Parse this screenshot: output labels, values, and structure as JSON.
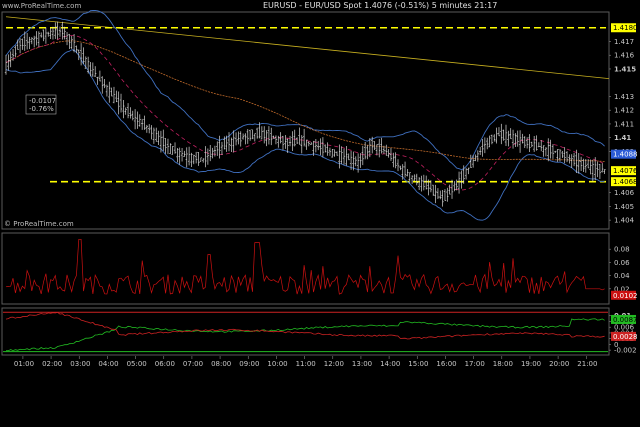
{
  "header": {
    "brand": "www.ProRealTime.com",
    "title": "EURUSD - EUR/USD Spot    1.4076 (-0.51%)    5 minutes  21:17"
  },
  "watermark": "© ProRealTime.com",
  "colors": {
    "background": "#000000",
    "price_bars": "#d8d8d8",
    "bollinger": "#3f6fbf",
    "moving_avg": "#c06a2a",
    "dashed_ma": "#c02060",
    "trendline": "#c8b020",
    "level_line": "#ffff00",
    "volatility": "#cc1111",
    "osc_green": "#22bb22",
    "osc_red": "#cc2222",
    "tag_yellow": "#ffff00",
    "tag_blue": "#2b5bd6"
  },
  "price_panel": {
    "y_ticks": [
      "1.417",
      "1.416",
      "1.415",
      "1.413",
      "1.412",
      "1.411",
      "1.41",
      "1.409",
      "1.406",
      "1.405",
      "1.404"
    ],
    "ylim": [
      1.4035,
      1.419
    ],
    "level_upper": {
      "value": 1.418,
      "label": "1.4180"
    },
    "level_lower": {
      "value": 1.4068,
      "label": "1.4068"
    },
    "last_price_label": "1.4076",
    "band_label": "1.4088",
    "change_box": [
      "-0.0107",
      "-0.76%"
    ]
  },
  "volatility_panel": {
    "y_ticks": [
      "0.08",
      "0.06",
      "0.04",
      "0.02"
    ],
    "ylim": [
      0,
      0.1
    ],
    "last_label": "0.0102"
  },
  "oscillator_panel": {
    "y_ticks": [
      "0.01",
      "0.008",
      "0.006",
      "0.004",
      "0.002",
      "0",
      "-0.002"
    ],
    "ylim": [
      -0.003,
      0.012
    ],
    "green_label": "0.0087",
    "red_label": "0.0028"
  },
  "x_axis": {
    "ticks": [
      "01:00",
      "02:00",
      "03:00",
      "04:00",
      "05:00",
      "06:00",
      "07:00",
      "08:00",
      "09:00",
      "10:00",
      "11:00",
      "12:00",
      "13:00",
      "14:00",
      "15:00",
      "16:00",
      "17:00",
      "18:00",
      "19:00",
      "20:00",
      "21:00"
    ]
  },
  "chart_data": {
    "type": "line",
    "x_hours": [
      0.0,
      0.5,
      1.0,
      1.5,
      2.0,
      2.5,
      3.0,
      3.5,
      4.0,
      4.5,
      5.0,
      5.5,
      6.0,
      6.5,
      7.0,
      7.5,
      8.0,
      8.5,
      9.0,
      9.5,
      10.0,
      10.5,
      11.0,
      11.5,
      12.0,
      12.5,
      13.0,
      13.5,
      14.0,
      14.5,
      15.0,
      15.5,
      16.0,
      16.5,
      17.0,
      17.5,
      18.0,
      18.5,
      19.0,
      19.5,
      20.0,
      20.5,
      21.0,
      21.3
    ],
    "price": [
      1.4152,
      1.4168,
      1.4172,
      1.4176,
      1.4178,
      1.4165,
      1.415,
      1.4138,
      1.4125,
      1.4115,
      1.4108,
      1.4098,
      1.409,
      1.4086,
      1.4084,
      1.4092,
      1.4097,
      1.4101,
      1.4103,
      1.41,
      1.4096,
      1.4098,
      1.4094,
      1.409,
      1.4086,
      1.4082,
      1.4095,
      1.409,
      1.4078,
      1.407,
      1.4064,
      1.4055,
      1.4065,
      1.408,
      1.4095,
      1.4102,
      1.41,
      1.4096,
      1.4093,
      1.409,
      1.4085,
      1.408,
      1.4077,
      1.4076
    ]
  }
}
